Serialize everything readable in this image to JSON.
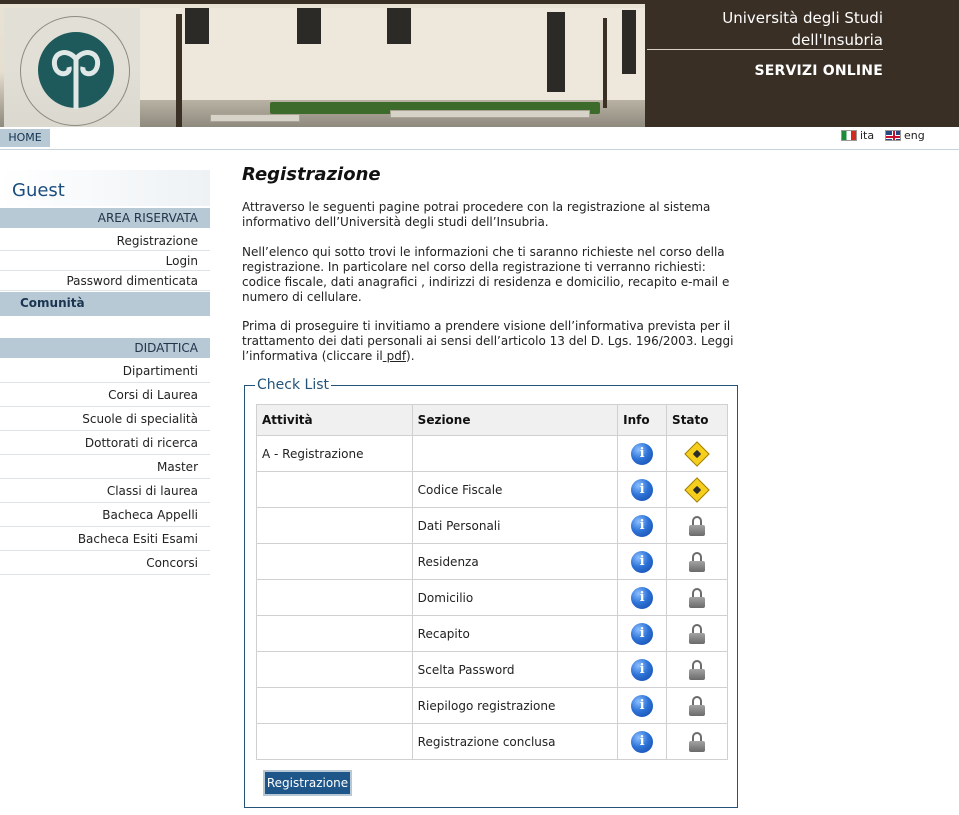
{
  "header": {
    "university_line1": "Università degli Studi",
    "university_line2": "dell'Insubria",
    "subtitle": "SERVIZI ONLINE",
    "logo_icon": "university-seal-icon"
  },
  "topbar": {
    "home_label": "HOME",
    "lang_it": "ita",
    "lang_en": "eng"
  },
  "sidebar": {
    "user": "Guest",
    "area_riservata": {
      "heading": "AREA RISERVATA",
      "items": [
        "Registrazione",
        "Login",
        "Password dimenticata"
      ]
    },
    "comunita": "Comunità",
    "didattica": {
      "heading": "DIDATTICA",
      "items": [
        "Dipartimenti",
        "Corsi di Laurea",
        "Scuole di specialità",
        "Dottorati di ricerca",
        "Master",
        "Classi di laurea",
        "Bacheca Appelli",
        "Bacheca Esiti Esami",
        "Concorsi"
      ]
    }
  },
  "main": {
    "title": "Registrazione",
    "para1": "Attraverso le seguenti pagine potrai procedere con la registrazione al sistema informativo dell’Università degli studi dell’Insubria.",
    "para2": "Nell’elenco qui sotto trovi le informazioni che ti saranno richieste nel corso della registrazione. In particolare nel corso della registrazione ti verranno richiesti: codice fiscale, dati anagrafici , indirizzi di residenza e domicilio, recapito e-mail e numero di cellulare.",
    "para3_text": "Prima di proseguire ti invitiamo a prendere visione dell’informativa prevista per il trattamento dei dati personali ai sensi dell’articolo 13 del D. Lgs. 196/2003. Leggi l’informativa (cliccare il",
    "para3_link": " pdf",
    "para3_end": ")."
  },
  "checklist": {
    "legend": "Check List",
    "columns": [
      "Attività",
      "Sezione",
      "Info",
      "Stato"
    ],
    "rows": [
      {
        "attivita": "A - Registrazione",
        "sezione": "",
        "stato": "warning"
      },
      {
        "attivita": "",
        "sezione": "Codice Fiscale",
        "stato": "warning"
      },
      {
        "attivita": "",
        "sezione": "Dati Personali",
        "stato": "locked"
      },
      {
        "attivita": "",
        "sezione": "Residenza",
        "stato": "locked"
      },
      {
        "attivita": "",
        "sezione": "Domicilio",
        "stato": "locked"
      },
      {
        "attivita": "",
        "sezione": "Recapito",
        "stato": "locked"
      },
      {
        "attivita": "",
        "sezione": "Scelta Password",
        "stato": "locked"
      },
      {
        "attivita": "",
        "sezione": "Riepilogo registrazione",
        "stato": "locked"
      },
      {
        "attivita": "",
        "sezione": "Registrazione conclusa",
        "stato": "locked"
      }
    ],
    "info_glyph": "i",
    "button_label": "Registrazione"
  },
  "colors": {
    "accent": "#1f5689",
    "sidebar_header": "#b8c9d6",
    "header_bg": "#3a2f25"
  }
}
